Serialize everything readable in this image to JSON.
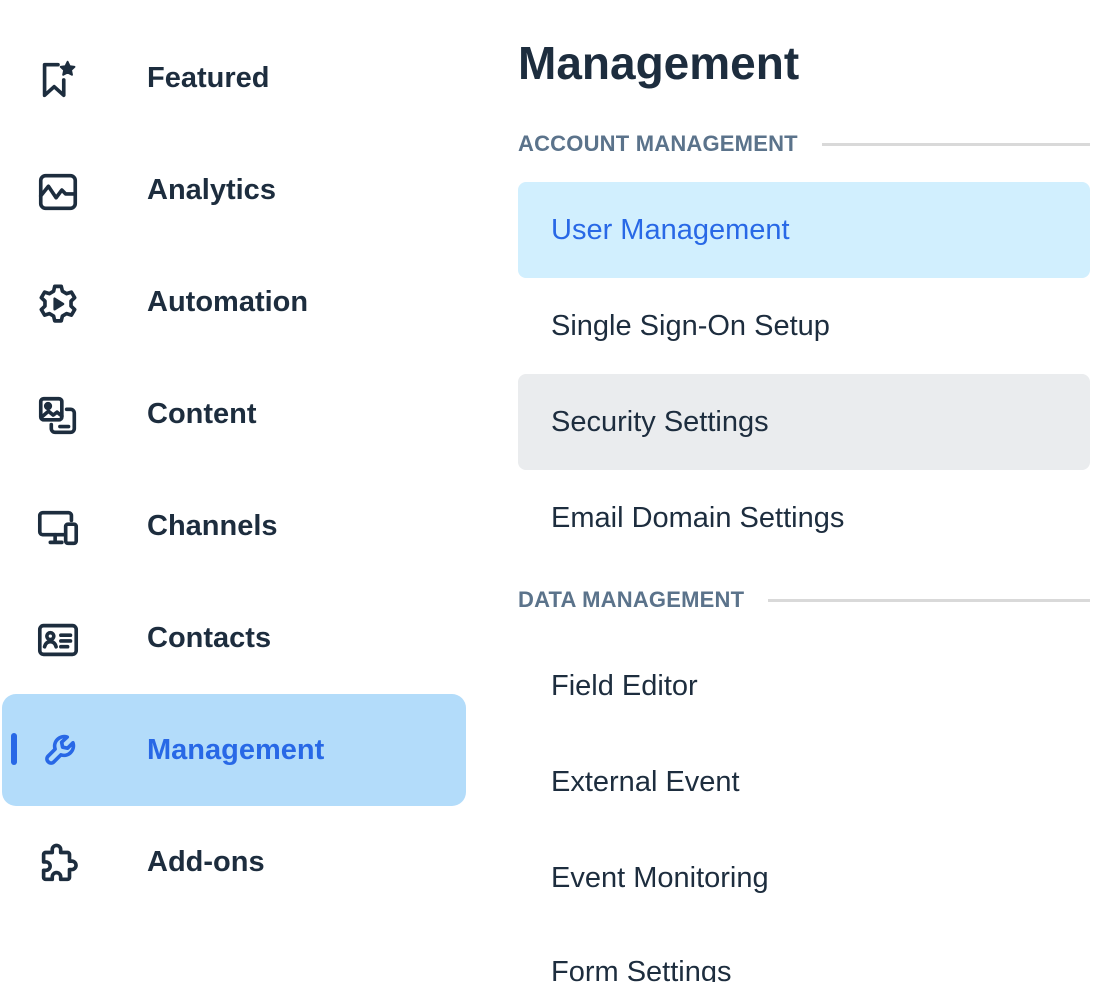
{
  "nav": {
    "items": [
      {
        "label": "Featured",
        "icon": "bookmark-star-icon",
        "active": false
      },
      {
        "label": "Analytics",
        "icon": "line-chart-icon",
        "active": false
      },
      {
        "label": "Automation",
        "icon": "gear-play-icon",
        "active": false
      },
      {
        "label": "Content",
        "icon": "images-icon",
        "active": false
      },
      {
        "label": "Channels",
        "icon": "monitor-phone-icon",
        "active": false
      },
      {
        "label": "Contacts",
        "icon": "contact-card-icon",
        "active": false
      },
      {
        "label": "Management",
        "icon": "wrench-icon",
        "active": true
      },
      {
        "label": "Add-ons",
        "icon": "puzzle-icon",
        "active": false
      }
    ]
  },
  "panel": {
    "title": "Management",
    "sections": [
      {
        "header": "ACCOUNT MANAGEMENT",
        "items": [
          {
            "label": "User Management",
            "state": "selected"
          },
          {
            "label": "Single Sign-On Setup",
            "state": "normal"
          },
          {
            "label": "Security Settings",
            "state": "hovered"
          },
          {
            "label": "Email Domain Settings",
            "state": "normal"
          }
        ]
      },
      {
        "header": "DATA MANAGEMENT",
        "items": [
          {
            "label": "Field Editor",
            "state": "normal"
          },
          {
            "label": "External Event",
            "state": "normal"
          },
          {
            "label": "Event Monitoring",
            "state": "normal"
          },
          {
            "label": "Form Settings",
            "state": "normal"
          }
        ]
      }
    ]
  },
  "colors": {
    "accent": "#2868e6",
    "nav_active_bg": "#b3dcfa",
    "menu_selected_bg": "#d1effe",
    "menu_hover_bg": "#eaecee",
    "text": "#1d2d3e",
    "section_header": "#5b738b"
  }
}
